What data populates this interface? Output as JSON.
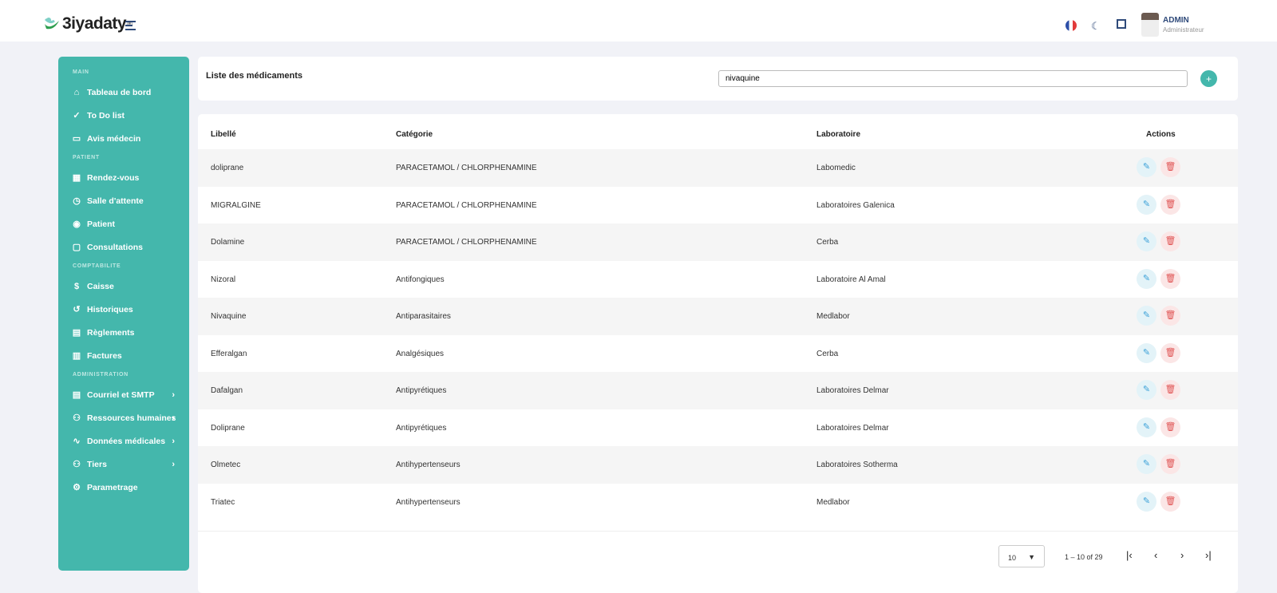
{
  "header": {
    "brand": "3iyadaty",
    "brand_mark": "®",
    "user_name": "ADMIN",
    "user_role": "Administrateur",
    "icons": [
      "france-flag-icon",
      "moon-icon",
      "fullscreen-icon"
    ]
  },
  "sidebar": {
    "sections": [
      {
        "label": "MAIN",
        "items": [
          {
            "label": "Tableau de bord",
            "icon": "⌂"
          },
          {
            "label": "To Do list",
            "icon": "✓"
          },
          {
            "label": "Avis médecin",
            "icon": "▭"
          }
        ]
      },
      {
        "label": "PATIENT",
        "items": [
          {
            "label": "Rendez-vous",
            "icon": "▦"
          },
          {
            "label": "Salle d'attente",
            "icon": "◷"
          },
          {
            "label": "Patient",
            "icon": "◉"
          },
          {
            "label": "Consultations",
            "icon": "▢"
          }
        ]
      },
      {
        "label": "COMPTABILITE",
        "items": [
          {
            "label": "Caisse",
            "icon": "$"
          },
          {
            "label": "Historiques",
            "icon": "↺"
          },
          {
            "label": "Règlements",
            "icon": "▤"
          },
          {
            "label": "Factures",
            "icon": "▥"
          }
        ]
      },
      {
        "label": "ADMINISTRATION",
        "items": [
          {
            "label": "Courriel et SMTP",
            "icon": "▤",
            "chevron": true
          },
          {
            "label": "Ressources humaines",
            "icon": "⚇",
            "chevron": true
          },
          {
            "label": "Données médicales",
            "icon": "∿",
            "chevron": true
          },
          {
            "label": "Tiers",
            "icon": "⚇",
            "chevron": true
          },
          {
            "label": "Parametrage",
            "icon": "⚙"
          }
        ]
      }
    ]
  },
  "list": {
    "title": "Liste des médicaments",
    "search_value": "nivaquine",
    "add_label": "+"
  },
  "table": {
    "columns": [
      "Libellé",
      "Catégorie",
      "Laboratoire",
      "Actions"
    ],
    "rows": [
      [
        "doliprane",
        "PARACETAMOL / CHLORPHENAMINE",
        "Labomedic"
      ],
      [
        "MIGRALGINE",
        "PARACETAMOL / CHLORPHENAMINE",
        "Laboratoires Galenica"
      ],
      [
        "Dolamine",
        "PARACETAMOL / CHLORPHENAMINE",
        "Cerba"
      ],
      [
        "Nizoral",
        "Antifongiques",
        "Laboratoire Al Amal"
      ],
      [
        "Nivaquine",
        "Antiparasitaires",
        "Medlabor"
      ],
      [
        "Efferalgan",
        "Analgésiques",
        "Cerba"
      ],
      [
        "Dafalgan",
        "Antipyrétiques",
        "Laboratoires Delmar"
      ],
      [
        "Doliprane",
        "Antipyrétiques",
        "Laboratoires Delmar"
      ],
      [
        "Olmetec",
        "Antihypertenseurs",
        "Laboratoires Sotherma"
      ],
      [
        "Triatec",
        "Antihypertenseurs",
        "Medlabor"
      ]
    ]
  },
  "pagination": {
    "page_size": "10",
    "range": "1 – 10 of 29",
    "first": "|‹",
    "prev": "‹",
    "next": "›",
    "last": "›|"
  },
  "colors": {
    "accent": "#44b7ac",
    "edit": "#3aa0d8",
    "delete": "#e05555"
  }
}
